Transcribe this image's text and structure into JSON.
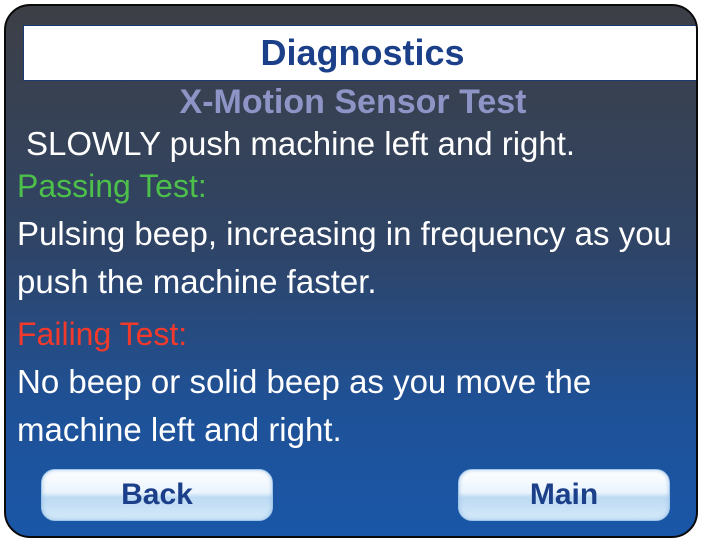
{
  "header": {
    "title": "Diagnostics",
    "subtitle": "X-Motion Sensor Test"
  },
  "content": {
    "instruction": "SLOWLY push machine left and right.",
    "passing_label": "Passing Test:",
    "passing_text": "Pulsing beep, increasing in frequency as you push the machine faster.",
    "failing_label": "Failing Test:",
    "failing_text": "No beep or solid beep as you move the machine left and right."
  },
  "buttons": {
    "back_label": "Back",
    "main_label": "Main"
  },
  "colors": {
    "title_text": "#1c3f8a",
    "subtitle_text": "#8e95c6",
    "pass_label": "#4cc04a",
    "fail_label": "#f23a2c",
    "background_top": "#3d3f46",
    "background_bottom": "#1a57a8"
  }
}
